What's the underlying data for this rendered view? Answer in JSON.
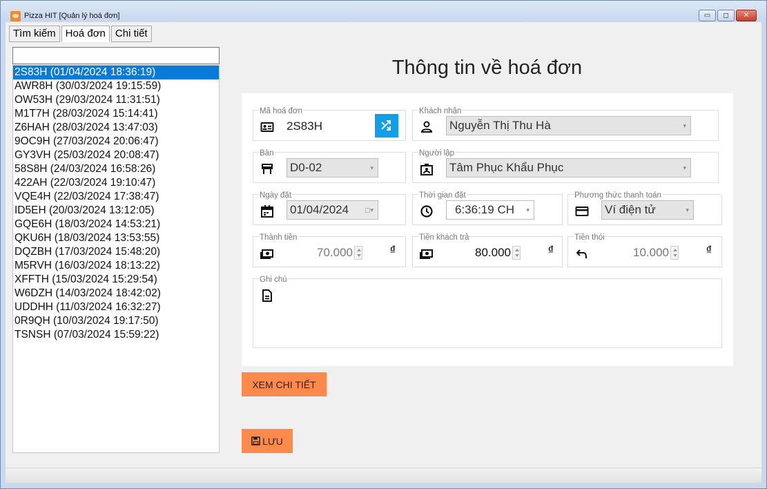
{
  "window": {
    "title": "Pizza HIT [Quản lý hoá đơn]",
    "controls": {
      "minimize": "▭",
      "maximize": "◻",
      "close": "✕"
    }
  },
  "tabs": [
    {
      "label": "Tìm kiếm",
      "active": false
    },
    {
      "label": "Hoá đơn",
      "active": true
    },
    {
      "label": "Chi tiết",
      "active": false
    }
  ],
  "search": {
    "value": ""
  },
  "invoice_list": [
    "2S83H (01/04/2024 18:36:19)",
    "AWR8H (30/03/2024 19:15:59)",
    "OW53H (29/03/2024 11:31:51)",
    "M1T7H (28/03/2024 15:14:41)",
    "Z6HAH (28/03/2024 13:47:03)",
    "9OC9H (27/03/2024 20:06:47)",
    "GY3VH (25/03/2024 20:08:47)",
    "58S8H (24/03/2024 16:58:26)",
    "422AH (22/03/2024 19:10:47)",
    "VQE4H (22/03/2024 17:38:47)",
    "ID5EH (20/03/2024 13:12:05)",
    "GQE6H (18/03/2024 14:53:21)",
    "QKU6H (18/03/2024 13:53:55)",
    "DQZBH (17/03/2024 15:48:20)",
    "M5RVH (16/03/2024 18:13:22)",
    "XFFTH (15/03/2024 15:29:54)",
    "W6DZH (14/03/2024 18:42:02)",
    "UDDHH (11/03/2024 16:32:27)",
    "0R9QH (10/03/2024 19:17:50)",
    "TSNSH (07/03/2024 15:59:22)"
  ],
  "selected_index": 0,
  "main": {
    "title": "Thông tin về hoá đơn",
    "fields": {
      "ma_hoa_don": {
        "label": "Mã hoá đơn",
        "value": "2S83H"
      },
      "khach_nhan": {
        "label": "Khách nhận",
        "value": "Nguyễn Thị Thu Hà"
      },
      "ban": {
        "label": "Bàn",
        "value": "D0-02"
      },
      "nguoi_lap": {
        "label": "Người lập",
        "value": "Tâm Phục Khẩu Phục"
      },
      "ngay_dat": {
        "label": "Ngày đặt",
        "value": "01/04/2024"
      },
      "thoi_gian_dat": {
        "label": "Thời gian đặt",
        "value": "6:36:19 CH"
      },
      "phuong_thuc": {
        "label": "Phương thức thanh toán",
        "value": "Ví điện tử"
      },
      "thanh_tien": {
        "label": "Thành tiền",
        "value": "70.000",
        "currency": "₫"
      },
      "tien_khach_tra": {
        "label": "Tiền khách trả",
        "value": "80.000",
        "currency": "₫"
      },
      "tien_thoi": {
        "label": "Tiền thói",
        "value": "10.000",
        "currency": "₫"
      },
      "ghi_chu": {
        "label": "Ghi chú",
        "value": ""
      }
    },
    "buttons": {
      "xem_chi_tiet": "XEM CHI TIẾT",
      "luu": "LƯU"
    }
  },
  "colors": {
    "accent": "#ff8a4c",
    "selection": "#0a7ad8",
    "shuffle": "#139ee8"
  }
}
